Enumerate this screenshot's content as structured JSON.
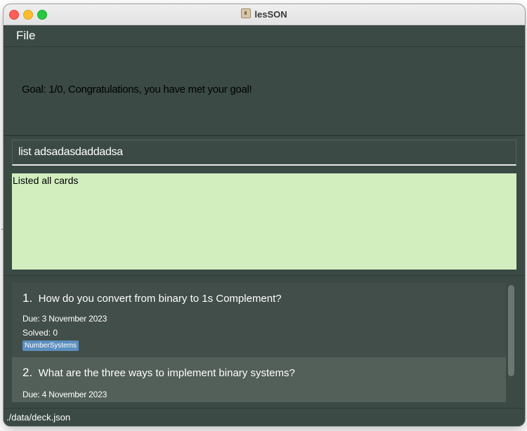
{
  "window": {
    "title": "lesSON",
    "app_icon": "user-card-icon",
    "traffic_lights": [
      "close",
      "minimize",
      "maximize"
    ]
  },
  "menu": {
    "file_label": "File"
  },
  "goal": {
    "text": "Goal: 1/0, Congratulations, you have met your goal!"
  },
  "command": {
    "value": "list adsadasdaddadsa",
    "placeholder": ""
  },
  "result": {
    "text": "Listed all cards"
  },
  "cards": [
    {
      "index": "1.",
      "question": "How do you convert from binary to 1s Complement?",
      "due": "Due: 3 November 2023",
      "solved": "Solved: 0",
      "tag": "NumberSystems"
    },
    {
      "index": "2.",
      "question": "What are the three ways to implement binary systems?",
      "due": "Due: 4 November 2023"
    }
  ],
  "status": {
    "path": "./data/deck.json"
  },
  "colors": {
    "window_bg": "#3b4a44",
    "result_bg": "#d2eebf",
    "card_bg": "#424e49",
    "card_selected_bg": "#535f59",
    "tag_bg": "#5b8fc0"
  }
}
